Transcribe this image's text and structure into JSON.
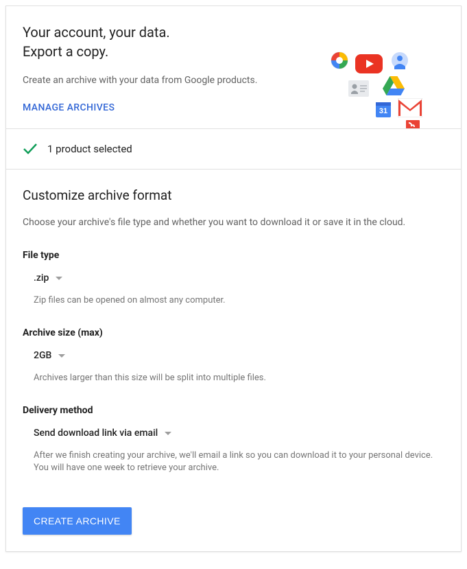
{
  "header": {
    "title_line1": "Your account, your data.",
    "title_line2": "Export a copy.",
    "subtitle": "Create an archive with your data from Google products.",
    "manage_link": "MANAGE ARCHIVES"
  },
  "status": {
    "text": "1 product selected"
  },
  "customize": {
    "title": "Customize archive format",
    "description": "Choose your archive's file type and whether you want to download it or save it in the cloud.",
    "file_type": {
      "label": "File type",
      "value": ".zip",
      "help": "Zip files can be opened on almost any computer."
    },
    "archive_size": {
      "label": "Archive size (max)",
      "value": "2GB",
      "help": "Archives larger than this size will be split into multiple files."
    },
    "delivery": {
      "label": "Delivery method",
      "value": "Send download link via email",
      "help": "After we finish creating your archive, we'll email a link so you can download it to your personal device. You will have one week to retrieve your archive."
    }
  },
  "create_button": "CREATE ARCHIVE"
}
